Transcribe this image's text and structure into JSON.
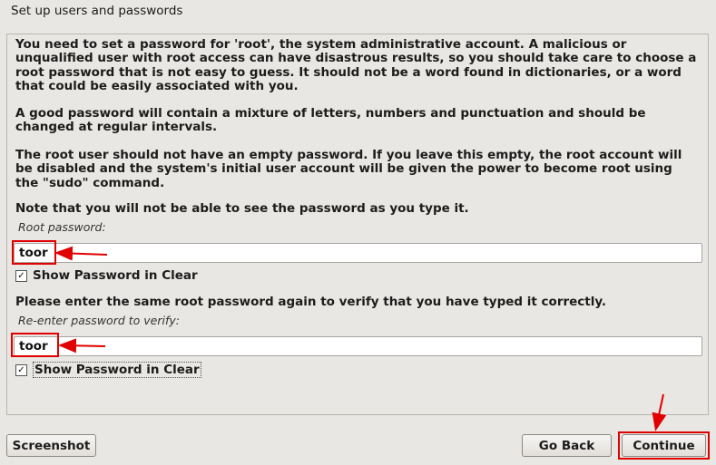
{
  "page": {
    "title": "Set up users and passwords"
  },
  "instructions": {
    "p1": "You need to set a password for 'root', the system administrative account. A malicious or unqualified user with root access can have disastrous results, so you should take care to choose a root password that is not easy to guess. It should not be a word found in dictionaries, or a word that could be easily associated with you.",
    "p2": "A good password will contain a mixture of letters, numbers and punctuation and should be changed at regular intervals.",
    "p3": "The root user should not have an empty password. If you leave this empty, the root account will be disabled and the system's initial user account will be given the power to become root using the \"sudo\" command.",
    "p4": "Note that you will not be able to see the password as you type it."
  },
  "root_password": {
    "label": "Root password:",
    "value": "toor",
    "show_clear_label": "Show Password in Clear",
    "show_clear_checked": "✓"
  },
  "verify": {
    "prompt": "Please enter the same root password again to verify that you have typed it correctly.",
    "label": "Re-enter password to verify:",
    "value": "toor",
    "show_clear_label": "Show Password in Clear",
    "show_clear_checked": "✓"
  },
  "buttons": {
    "screenshot": "Screenshot",
    "go_back": "Go Back",
    "continue": "Continue"
  },
  "colors": {
    "annotation": "#e00000",
    "background": "#e9e7e3"
  }
}
